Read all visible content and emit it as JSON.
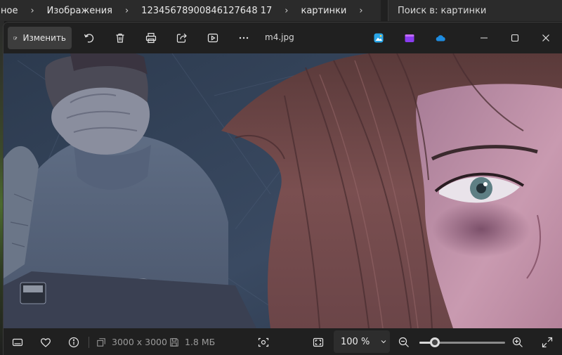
{
  "explorer": {
    "breadcrumb": [
      "ное",
      "Изображения",
      "12345678900846127648 17",
      "картинки"
    ],
    "search_placeholder": "Поиск в: картинки"
  },
  "viewer": {
    "edit_label": "Изменить",
    "file_name": "m4.jpg",
    "icons": [
      "rotate-icon",
      "delete-icon",
      "print-icon",
      "share-icon",
      "slideshow-icon",
      "more-icon"
    ],
    "cloud_apps": [
      "photo-editor-icon",
      "clipchamp-icon",
      "onedrive-icon"
    ]
  },
  "status": {
    "dimensions": "3000 x 3000",
    "file_size": "1.8 МБ",
    "zoom_label": "100 %",
    "zoom_level": 0.18
  },
  "colors": {
    "accent_edit": "#3d3d3d",
    "onedrive": "#1e8ce0",
    "clipchamp": "#8a3cf0",
    "photo_editor": "#2aa6e8"
  }
}
